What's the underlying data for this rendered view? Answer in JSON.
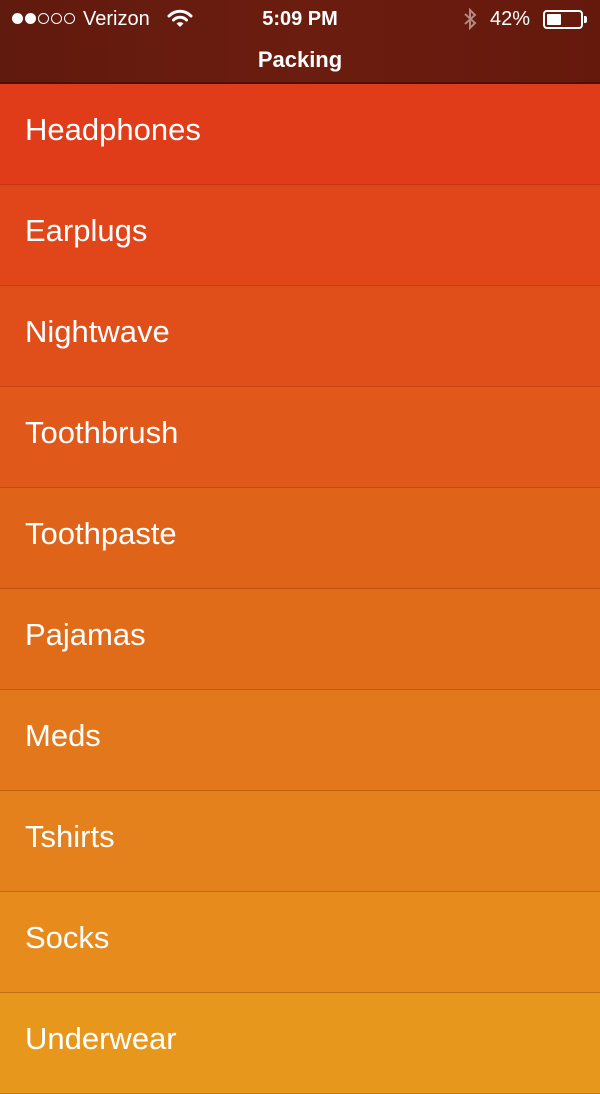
{
  "status_bar": {
    "signal_bars": 2,
    "signal_total": 5,
    "carrier": "Verizon",
    "time": "5:09 PM",
    "battery_percent": "42%",
    "battery_level": 0.42,
    "icons": [
      "wifi-icon",
      "bluetooth-icon",
      "battery-icon"
    ]
  },
  "nav": {
    "title": "Packing"
  },
  "list": {
    "items": [
      {
        "label": "Headphones",
        "color": "#e03c1a"
      },
      {
        "label": "Earplugs",
        "color": "#e0461a"
      },
      {
        "label": "Nightwave",
        "color": "#e04f1a"
      },
      {
        "label": "Toothbrush",
        "color": "#e0591a"
      },
      {
        "label": "Toothpaste",
        "color": "#e0631a"
      },
      {
        "label": "Pajamas",
        "color": "#e06c1a"
      },
      {
        "label": "Meds",
        "color": "#e3771b"
      },
      {
        "label": "Tshirts",
        "color": "#e5811c"
      },
      {
        "label": "Socks",
        "color": "#e68b1c"
      },
      {
        "label": "Underwear",
        "color": "#e8971d"
      }
    ]
  }
}
